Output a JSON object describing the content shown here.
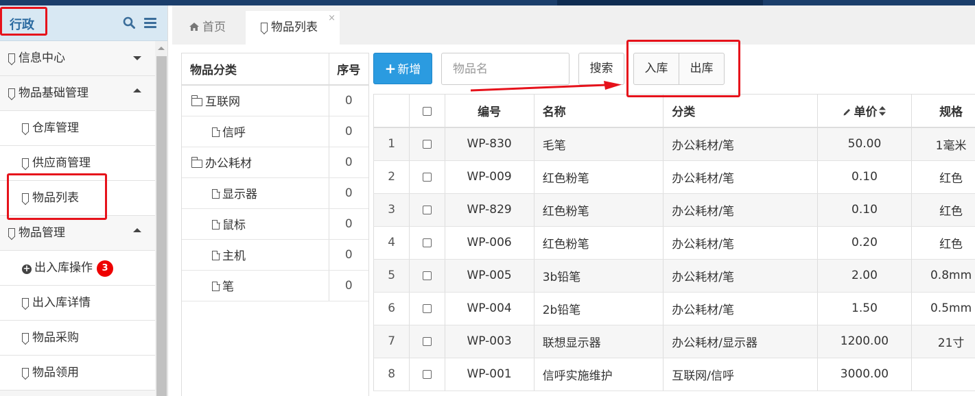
{
  "sidebar": {
    "title": "行政",
    "icons": {
      "search": "search-icon",
      "menu": "menu-icon"
    },
    "items": [
      {
        "label": "信息中心",
        "level": 1,
        "arrow": "down"
      },
      {
        "label": "物品基础管理",
        "level": 1,
        "arrow": "up"
      },
      {
        "label": "仓库管理",
        "level": 2
      },
      {
        "label": "供应商管理",
        "level": 2
      },
      {
        "label": "物品列表",
        "level": 2
      },
      {
        "label": "物品管理",
        "level": 1,
        "arrow": "up"
      },
      {
        "label": "出入库操作",
        "level": 2,
        "badge": "3"
      },
      {
        "label": "出入库详情",
        "level": 2
      },
      {
        "label": "物品采购",
        "level": 2
      },
      {
        "label": "物品领用",
        "level": 2
      }
    ]
  },
  "tabs": {
    "home": "首页",
    "active": "物品列表",
    "close": "×"
  },
  "category": {
    "headers": {
      "name": "物品分类",
      "order": "序号"
    },
    "rows": [
      {
        "name": "互联网",
        "order": "0",
        "type": "folder"
      },
      {
        "name": "信呼",
        "order": "0",
        "type": "file"
      },
      {
        "name": "办公耗材",
        "order": "0",
        "type": "folder"
      },
      {
        "name": "显示器",
        "order": "0",
        "type": "file"
      },
      {
        "name": "鼠标",
        "order": "0",
        "type": "file"
      },
      {
        "name": "主机",
        "order": "0",
        "type": "file"
      },
      {
        "name": "笔",
        "order": "0",
        "type": "file"
      }
    ]
  },
  "toolbar": {
    "new_label": "新增",
    "search_placeholder": "物品名",
    "search_label": "搜索",
    "in_label": "入库",
    "out_label": "出库"
  },
  "items": {
    "headers": {
      "code": "编号",
      "name": "名称",
      "category": "分类",
      "price": "单价",
      "spec": "规格"
    },
    "rows": [
      {
        "n": "1",
        "code": "WP-830",
        "name": "毛笔",
        "category": "办公耗材/笔",
        "price": "50.00",
        "spec": "1毫米"
      },
      {
        "n": "2",
        "code": "WP-009",
        "name": "红色粉笔",
        "category": "办公耗材/笔",
        "price": "0.10",
        "spec": "红色"
      },
      {
        "n": "3",
        "code": "WP-829",
        "name": "红色粉笔",
        "category": "办公耗材/笔",
        "price": "0.10",
        "spec": "红色"
      },
      {
        "n": "4",
        "code": "WP-006",
        "name": "红色粉笔",
        "category": "办公耗材/笔",
        "price": "0.20",
        "spec": "红色"
      },
      {
        "n": "5",
        "code": "WP-005",
        "name": "3b铅笔",
        "category": "办公耗材/笔",
        "price": "2.00",
        "spec": "0.8mm"
      },
      {
        "n": "6",
        "code": "WP-004",
        "name": "2b铅笔",
        "category": "办公耗材/笔",
        "price": "1.50",
        "spec": "0.5mm"
      },
      {
        "n": "7",
        "code": "WP-003",
        "name": "联想显示器",
        "category": "办公耗材/显示器",
        "price": "1200.00",
        "spec": "21寸"
      },
      {
        "n": "8",
        "code": "WP-001",
        "name": "信呼实施维护",
        "category": "互联网/信呼",
        "price": "3000.00",
        "spec": ""
      }
    ]
  },
  "colors": {
    "primary": "#2b9be0",
    "annotation": "#e6121b",
    "badge": "#ee0000"
  }
}
